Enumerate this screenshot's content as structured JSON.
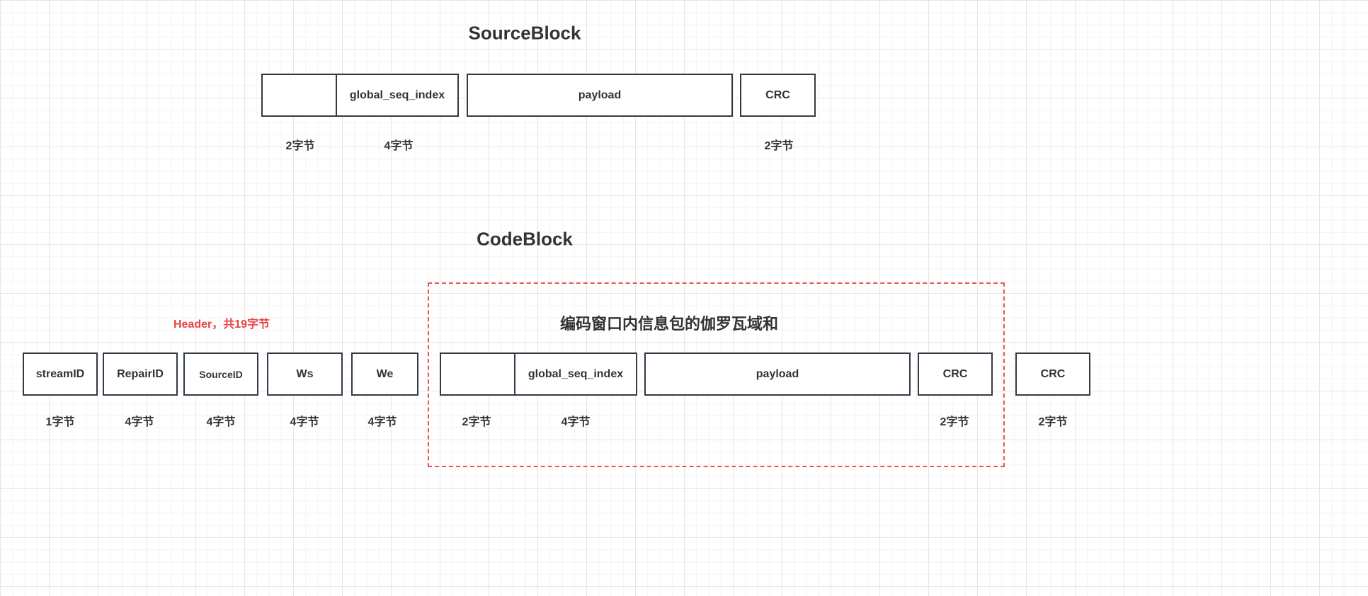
{
  "source_block": {
    "title": "SourceBlock",
    "fields": [
      "",
      "global_seq_index",
      "payload",
      "CRC"
    ],
    "sizes": [
      "2字节",
      "4字节",
      "2字节"
    ]
  },
  "code_block": {
    "title": "CodeBlock",
    "header_label": "Header，共19字节",
    "header_fields": [
      "streamID",
      "RepairID",
      "SourceID",
      "Ws",
      "We"
    ],
    "header_sizes": [
      "1字节",
      "4字节",
      "4字节",
      "4字节",
      "4字节"
    ],
    "group_title": "编码窗口内信息包的伽罗瓦域和",
    "group_fields": [
      "",
      "global_seq_index",
      "payload",
      "CRC"
    ],
    "group_sizes": [
      "2字节",
      "4字节",
      "2字节"
    ],
    "trailer_field": "CRC",
    "trailer_size": "2字节"
  },
  "colors": {
    "accent": "#e84545",
    "border": "#333a45"
  }
}
